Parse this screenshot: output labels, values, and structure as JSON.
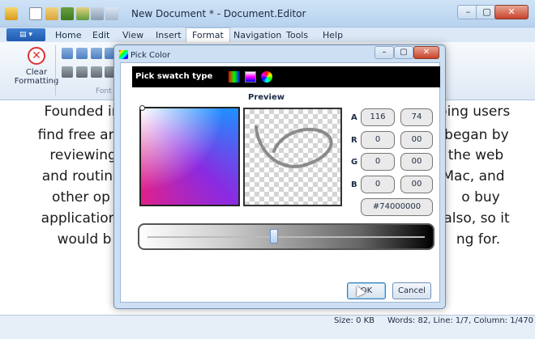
{
  "window": {
    "title": "New Document * - Document.Editor",
    "minimize": "–",
    "maximize": "▢",
    "close": "✕"
  },
  "app_button": "▤ ▾",
  "menu": [
    "Home",
    "Edit",
    "View",
    "Insert",
    "Format",
    "Navigation",
    "Tools",
    "Help"
  ],
  "ribbon": {
    "clear_formatting": "Clear Formatting",
    "clear_icon": "✕",
    "group_label": "Font"
  },
  "document": {
    "lines": [
      "Founded in 20",
      "find free and s",
      "reviewing th",
      "and routinely",
      "other op",
      "applications",
      "would b"
    ],
    "lines_right": [
      "ping users",
      "e began by",
      "the web",
      "Mac, and",
      "o buy",
      "also, so it",
      "ng for."
    ]
  },
  "status": {
    "size": "Size: 0 KB",
    "words": "Words: 82, Line: 1/7, Column: 1/470"
  },
  "dialog": {
    "title": "Pick Color",
    "swatch_type_label": "Pick swatch type",
    "preview_label": "Preview",
    "channels": [
      {
        "label": "A",
        "dec": "116",
        "hex": "74"
      },
      {
        "label": "R",
        "dec": "0",
        "hex": "00"
      },
      {
        "label": "G",
        "dec": "0",
        "hex": "00"
      },
      {
        "label": "B",
        "dec": "0",
        "hex": "00"
      }
    ],
    "hex_value": "#74000000",
    "ok": "OK",
    "cancel": "Cancel",
    "alpha_slider_value": 0.455
  },
  "colors": {
    "accent": "#1f5ab0",
    "titlebar": "#c6dcf2",
    "close": "#c9432b"
  }
}
